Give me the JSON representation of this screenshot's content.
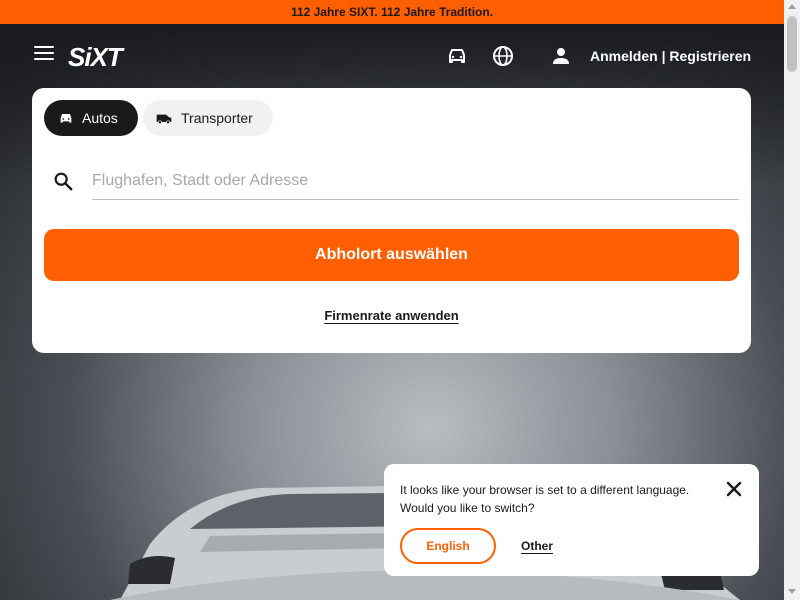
{
  "banner": {
    "text": "112 Jahre SIXT. 112 Jahre Tradition."
  },
  "header": {
    "logo": "SiXT",
    "icons": {
      "menu": "hamburger-icon",
      "car": "car-icon",
      "language": "globe-icon",
      "user": "user-icon"
    },
    "login_label": "Anmelden | Registrieren"
  },
  "booking": {
    "tabs": [
      {
        "label": "Autos",
        "icon": "car-icon",
        "active": true
      },
      {
        "label": "Transporter",
        "icon": "van-icon",
        "active": false
      }
    ],
    "search": {
      "placeholder": "Flughafen, Stadt oder Adresse",
      "value": ""
    },
    "pickup_button": "Abholort auswählen",
    "corporate_link": "Firmenrate anwenden"
  },
  "language_popup": {
    "message": "It looks like your browser is set to a different language. Would you like to switch?",
    "primary_button": "English",
    "secondary_link": "Other"
  },
  "colors": {
    "brand": "#ff5f00",
    "dark": "#1a1a1a",
    "white": "#ffffff"
  }
}
